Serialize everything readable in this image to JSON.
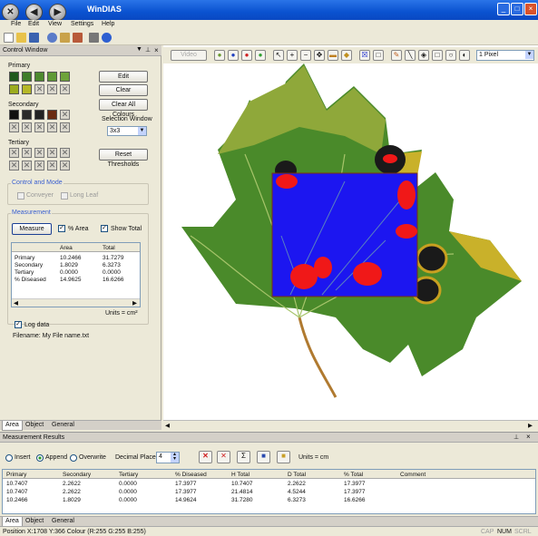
{
  "window": {
    "title": "WinDIAS",
    "min": "_",
    "max": "□",
    "close": "×"
  },
  "menus": [
    "File",
    "Edit",
    "View",
    "Settings",
    "Help"
  ],
  "control": {
    "title": "Control Window",
    "primary_label": "Primary",
    "secondary_label": "Secondary",
    "tertiary_label": "Tertiary",
    "edit": "Edit",
    "clear": "Clear",
    "clear_all": "Clear All Colours",
    "selection_window_label": "Selection Window",
    "selection_window_value": "3x3",
    "reset_thresholds": "Reset Thresholds",
    "control_mode_label": "Control and Mode",
    "conveyer": "Conveyer",
    "long_leaf": "Long Leaf",
    "measurement_label": "Measurement",
    "measure": "Measure",
    "pct_area": "% Area",
    "show_total": "Show Total",
    "table_headers": [
      "",
      "Area",
      "Total"
    ],
    "table_rows": [
      [
        "Primary",
        "10.2466",
        "31.7279"
      ],
      [
        "Secondary",
        "1.8029",
        "6.3273"
      ],
      [
        "Tertiary",
        "0.0000",
        "0.0000"
      ],
      [
        "% Diseased",
        "14.9625",
        "16.6266"
      ]
    ],
    "units": "Units = cm²",
    "log_data": "Log data",
    "filename": "Filename: My File name.txt",
    "colors": {
      "primary": [
        "#1f5a1c",
        "#3f7d28",
        "#4e8a2e",
        "#5f9a36",
        "#6ea33a",
        "#9cac1e",
        "#b6b828"
      ],
      "secondary": [
        "#111111",
        "#2a2a2a",
        "#222222",
        "#6a2b12"
      ]
    }
  },
  "tabs": [
    "Area",
    "Object",
    "General"
  ],
  "viewer_toolbar": {
    "video": "Video",
    "pixel_select": "1 Pixel"
  },
  "results": {
    "title": "Measurement Results",
    "insert": "Insert",
    "append": "Append",
    "overwrite": "Overwrite",
    "decimal_places": "Decimal Places",
    "decimal_value": "4",
    "units": "Units = cm",
    "headers": [
      "Primary",
      "Secondary",
      "Tertiary",
      "% Diseased",
      "H Total",
      "D Total",
      "% Total",
      "Comment"
    ],
    "rows": [
      [
        "10.7407",
        "2.2622",
        "0.0000",
        "17.3977",
        "10.7407",
        "2.2622",
        "17.3977",
        ""
      ],
      [
        "10.7407",
        "2.2622",
        "0.0000",
        "17.3977",
        "21.4814",
        "4.5244",
        "17.3977",
        ""
      ],
      [
        "10.2466",
        "1.8029",
        "0.0000",
        "14.9624",
        "31.7280",
        "6.3273",
        "16.6266",
        ""
      ]
    ]
  },
  "status": {
    "position": "Position  X:1708 Y:366  Colour (R:255 G:255 B:255)",
    "cap": "CAP",
    "num": "NUM",
    "scrl": "SCRL"
  }
}
